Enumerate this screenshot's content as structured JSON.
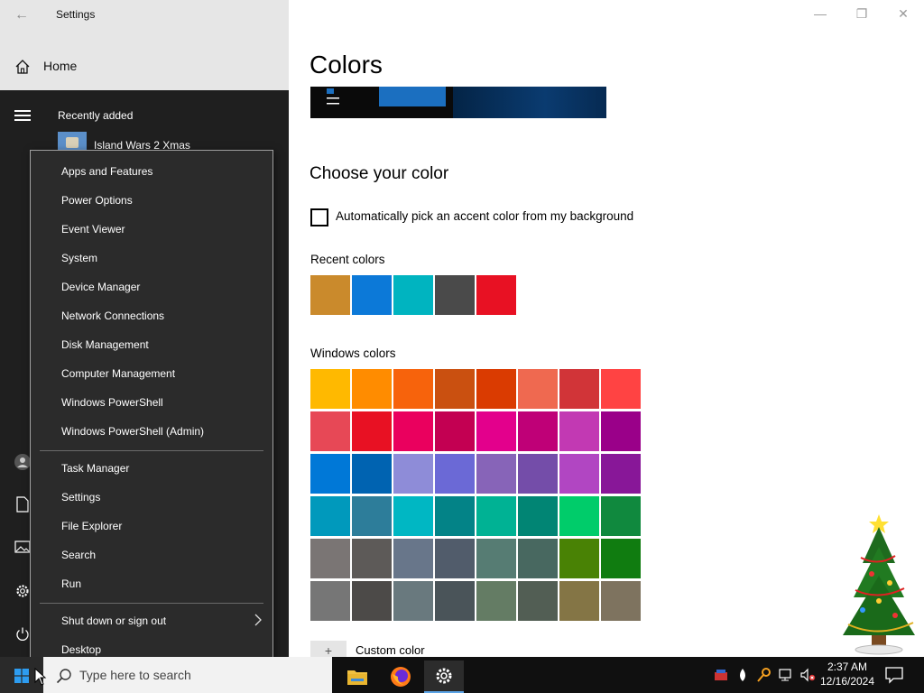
{
  "window": {
    "title": "Settings",
    "back_glyph": "←",
    "minimize_glyph": "—",
    "restore_glyph": "❐",
    "close_glyph": "✕"
  },
  "nav": {
    "home_label": "Home"
  },
  "start_menu": {
    "recent_label": "Recently added",
    "recent_app": "Island Wars 2 Xmas"
  },
  "context_menu": {
    "group1": [
      "Apps and Features",
      "Power Options",
      "Event Viewer",
      "System",
      "Device Manager",
      "Network Connections",
      "Disk Management",
      "Computer Management",
      "Windows PowerShell",
      "Windows PowerShell (Admin)"
    ],
    "group2": [
      "Task Manager",
      "Settings",
      "File Explorer",
      "Search",
      "Run"
    ],
    "group3": [
      "Shut down or sign out",
      "Desktop"
    ]
  },
  "content": {
    "page_title": "Colors",
    "section_title": "Choose your color",
    "auto_accent_label": "Automatically pick an accent color from my background",
    "recent_colors_label": "Recent colors",
    "windows_colors_label": "Windows colors",
    "custom_color_label": "Custom color",
    "custom_plus": "+"
  },
  "recent_colors": [
    "#CA8A2C",
    "#0C79D8",
    "#00B4C0",
    "#4A4A4A",
    "#E81123"
  ],
  "windows_colors": [
    [
      "#FFB900",
      "#FF8C00",
      "#F7630C",
      "#CA5010",
      "#DA3B01",
      "#EF6950",
      "#D13438",
      "#FF4343"
    ],
    [
      "#E74856",
      "#E81123",
      "#EA005E",
      "#C30052",
      "#E3008C",
      "#BF0077",
      "#C239B3",
      "#9A0089"
    ],
    [
      "#0078D7",
      "#0063B1",
      "#8E8CD8",
      "#6B69D6",
      "#8764B8",
      "#744DA9",
      "#B146C2",
      "#881798"
    ],
    [
      "#0099BC",
      "#2D7D9A",
      "#00B7C3",
      "#038387",
      "#00B294",
      "#018574",
      "#00CC6A",
      "#10893E"
    ],
    [
      "#7A7574",
      "#5D5A58",
      "#68768A",
      "#515C6B",
      "#567C73",
      "#486860",
      "#498205",
      "#107C10"
    ],
    [
      "#767676",
      "#4C4A48",
      "#69797E",
      "#4A5459",
      "#647C64",
      "#525E54",
      "#847545",
      "#7E735F"
    ]
  ],
  "taskbar": {
    "search_placeholder": "Type here to search",
    "time": "2:37 AM",
    "date": "12/16/2024"
  },
  "colors": {
    "accent": "#0078D7",
    "start_bg": "#1F1F1F",
    "menu_bg": "#2B2B2B"
  }
}
